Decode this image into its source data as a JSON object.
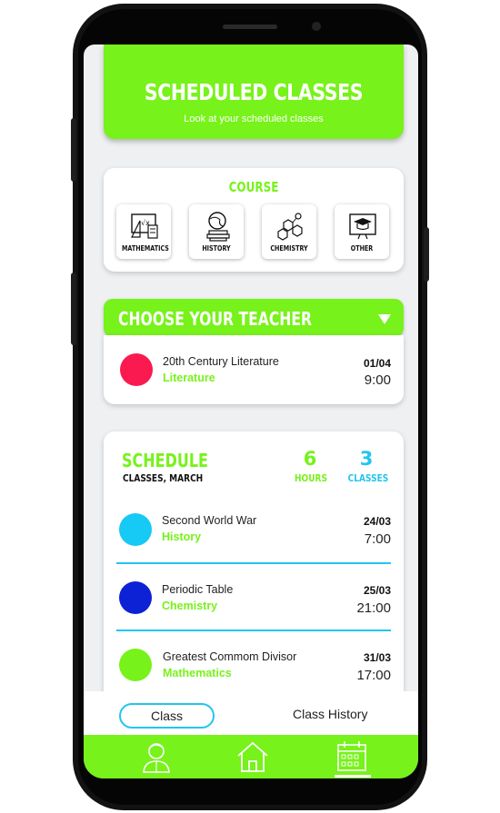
{
  "header": {
    "title": "SCHEDULED CLASSES",
    "subtitle": "Look at your scheduled classes"
  },
  "course": {
    "title": "COURSE",
    "items": [
      {
        "label": "MATHEMATICS",
        "icon": "mathematics-icon"
      },
      {
        "label": "HISTORY",
        "icon": "globe-books-icon"
      },
      {
        "label": "CHEMISTRY",
        "icon": "molecule-icon"
      },
      {
        "label": "OTHER",
        "icon": "graduation-cap-icon"
      }
    ]
  },
  "teacher": {
    "title": "CHOOSE YOUR TEACHER",
    "item": {
      "name": "20th Century Literature",
      "subject": "Literature",
      "date": "01/04",
      "time": "9:00",
      "color": "#fa1a50"
    }
  },
  "schedule": {
    "title": "SCHEDULE",
    "subtitle": "CLASSES, MARCH",
    "hours_value": "6",
    "hours_label": "HOURS",
    "classes_value": "3",
    "classes_label": "CLASSES",
    "items": [
      {
        "name": "Second World War",
        "subject": "History",
        "date": "24/03",
        "time": "7:00",
        "color": "#17c9f5"
      },
      {
        "name": "Periodic Table",
        "subject": "Chemistry",
        "date": "25/03",
        "time": "21:00",
        "color": "#0c22d4"
      },
      {
        "name": "Greatest Commom Divisor",
        "subject": "Mathematics",
        "date": "31/03",
        "time": "17:00",
        "color": "#77f21a"
      }
    ]
  },
  "tabs": {
    "class_label": "Class",
    "history_label": "Class History"
  },
  "nav": [
    "profile-icon",
    "home-icon",
    "calendar-icon"
  ],
  "colors": {
    "accent": "#77f21a",
    "blue": "#22c5f0"
  }
}
